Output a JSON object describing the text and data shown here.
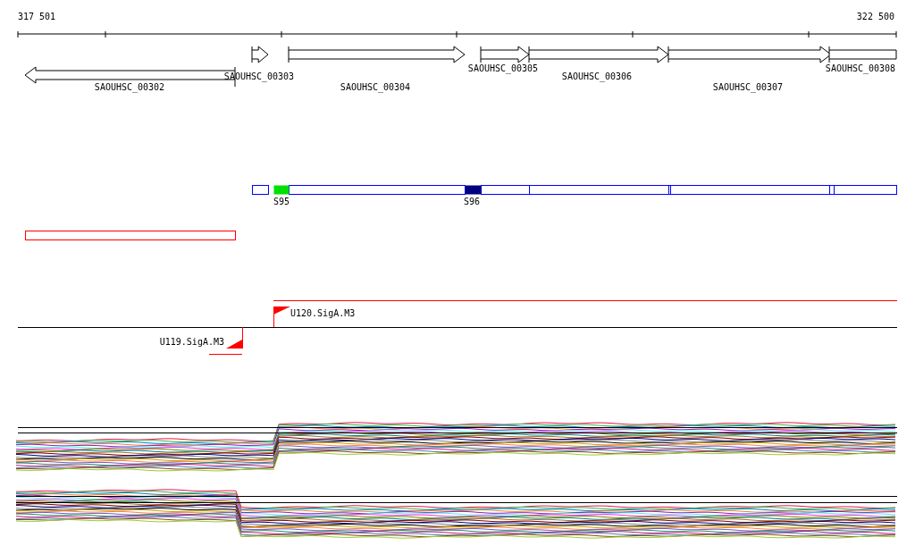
{
  "ruler": {
    "start_label": "317 501",
    "end_label": "322 500"
  },
  "genes": [
    {
      "name": "SAOUHSC_00302",
      "kind": "reverse"
    },
    {
      "name": "SAOUHSC_00303",
      "kind": "forward"
    },
    {
      "name": "SAOUHSC_00304",
      "kind": "forward"
    },
    {
      "name": "SAOUHSC_00305",
      "kind": "forward"
    },
    {
      "name": "SAOUHSC_00306",
      "kind": "forward"
    },
    {
      "name": "SAOUHSC_00307",
      "kind": "forward"
    },
    {
      "name": "SAOUHSC_00308",
      "kind": "partial"
    }
  ],
  "segments": [
    {
      "label": "S95",
      "color": "#00e000"
    },
    {
      "label": "S96",
      "color": "#000080"
    }
  ],
  "promoters": [
    {
      "label": "U120.SigA.M3",
      "kind": "forward"
    },
    {
      "label": "U119.SigA.M3",
      "kind": "reverse"
    }
  ]
}
